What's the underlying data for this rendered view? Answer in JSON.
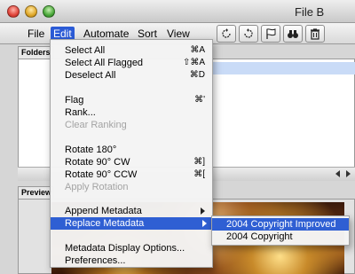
{
  "window": {
    "title": "File B"
  },
  "menubar": {
    "file": "File",
    "edit": "Edit",
    "automate": "Automate",
    "sort": "Sort",
    "view": "View"
  },
  "toolbar": {
    "buttons": [
      "rotate-ccw-icon",
      "rotate-cw-icon",
      "flag-icon",
      "binoculars-icon",
      "trash-icon"
    ]
  },
  "panels": {
    "folders_tab": "Folders",
    "preview_tab": "Preview"
  },
  "edit_menu": {
    "select_all": "Select All",
    "select_all_sc": "⌘A",
    "select_all_flagged": "Select All Flagged",
    "select_all_flagged_sc": "⇧⌘A",
    "deselect_all": "Deselect All",
    "deselect_all_sc": "⌘D",
    "flag": "Flag",
    "flag_sc": "⌘'",
    "rank": "Rank...",
    "clear_ranking": "Clear Ranking",
    "rotate_180": "Rotate 180°",
    "rotate_90_cw": "Rotate 90° CW",
    "rotate_90_cw_sc": "⌘]",
    "rotate_90_ccw": "Rotate 90° CCW",
    "rotate_90_ccw_sc": "⌘[",
    "apply_rotation": "Apply Rotation",
    "append_metadata": "Append Metadata",
    "replace_metadata": "Replace Metadata",
    "metadata_display_options": "Metadata Display Options...",
    "preferences": "Preferences..."
  },
  "submenu": {
    "items": [
      "2004 Copyright Improved",
      "2004 Copyright"
    ]
  },
  "colors": {
    "highlight": "#2f5fd3",
    "disabled_text": "#a3a3a3"
  }
}
